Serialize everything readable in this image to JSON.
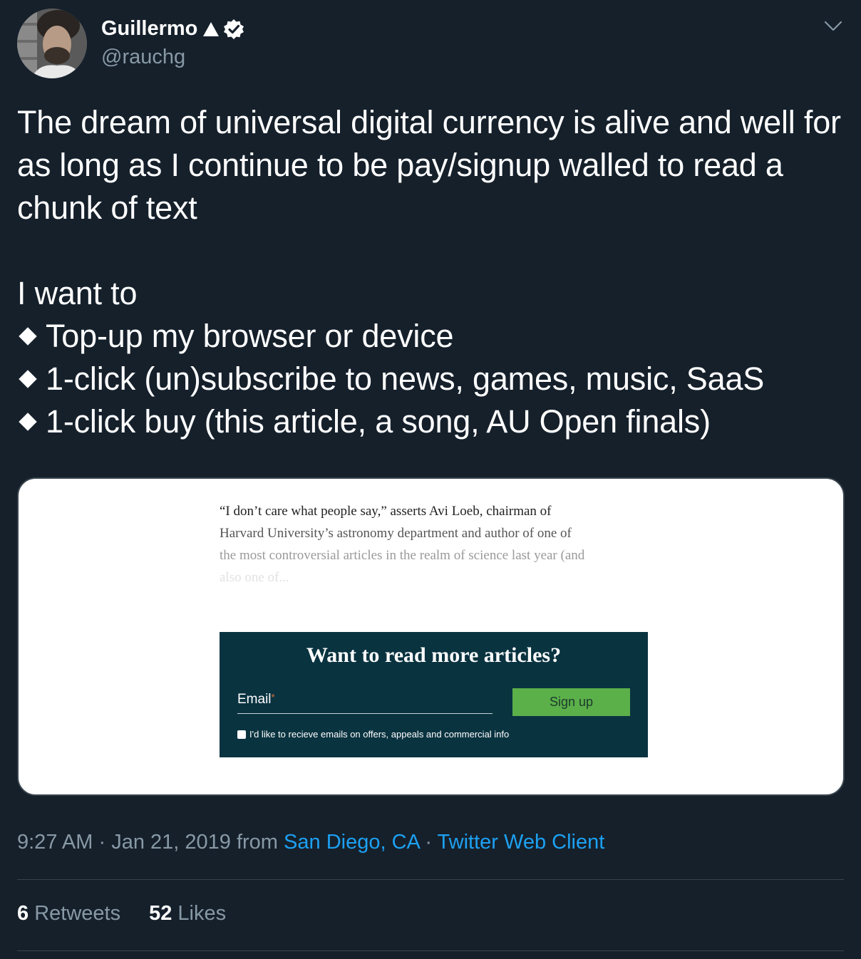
{
  "author": {
    "name": "Guillermo",
    "handle": "@rauchg"
  },
  "tweet": {
    "lines": [
      "The dream of universal digital currency is alive and well for",
      "as long as I continue to be pay/signup walled to read a",
      "chunk of text"
    ],
    "intro": "I want to",
    "bullets": [
      "Top-up my browser or device",
      "1-click (un)subscribe to news, games, music, SaaS",
      "1-click buy (this article, a song, AU Open finals)"
    ]
  },
  "media": {
    "excerpt": [
      "“I don’t care what people say,” asserts Avi Loeb, chairman of",
      "Harvard University’s astronomy department and author of one of",
      "the most controversial articles in the realm of science last year (and",
      "also one of..."
    ],
    "paywall": {
      "title": "Want to read more articles?",
      "email_label": "Email",
      "required_mark": "*",
      "signup_label": "Sign up",
      "optin_text": "I'd like to recieve emails on offers, appeals and commercial info"
    }
  },
  "meta": {
    "time": "9:27 AM",
    "separator": "·",
    "date": "Jan 21, 2019",
    "from": "from",
    "location": "San Diego, CA",
    "client": "Twitter Web Client"
  },
  "stats": {
    "retweets_count": "6",
    "retweets_label": "Retweets",
    "likes_count": "52",
    "likes_label": "Likes"
  },
  "colors": {
    "background": "#15202b",
    "link": "#1da1f2",
    "secondary_text": "#8899a6",
    "paywall_bg": "#0a3340",
    "signup_button": "#5bb04a"
  }
}
